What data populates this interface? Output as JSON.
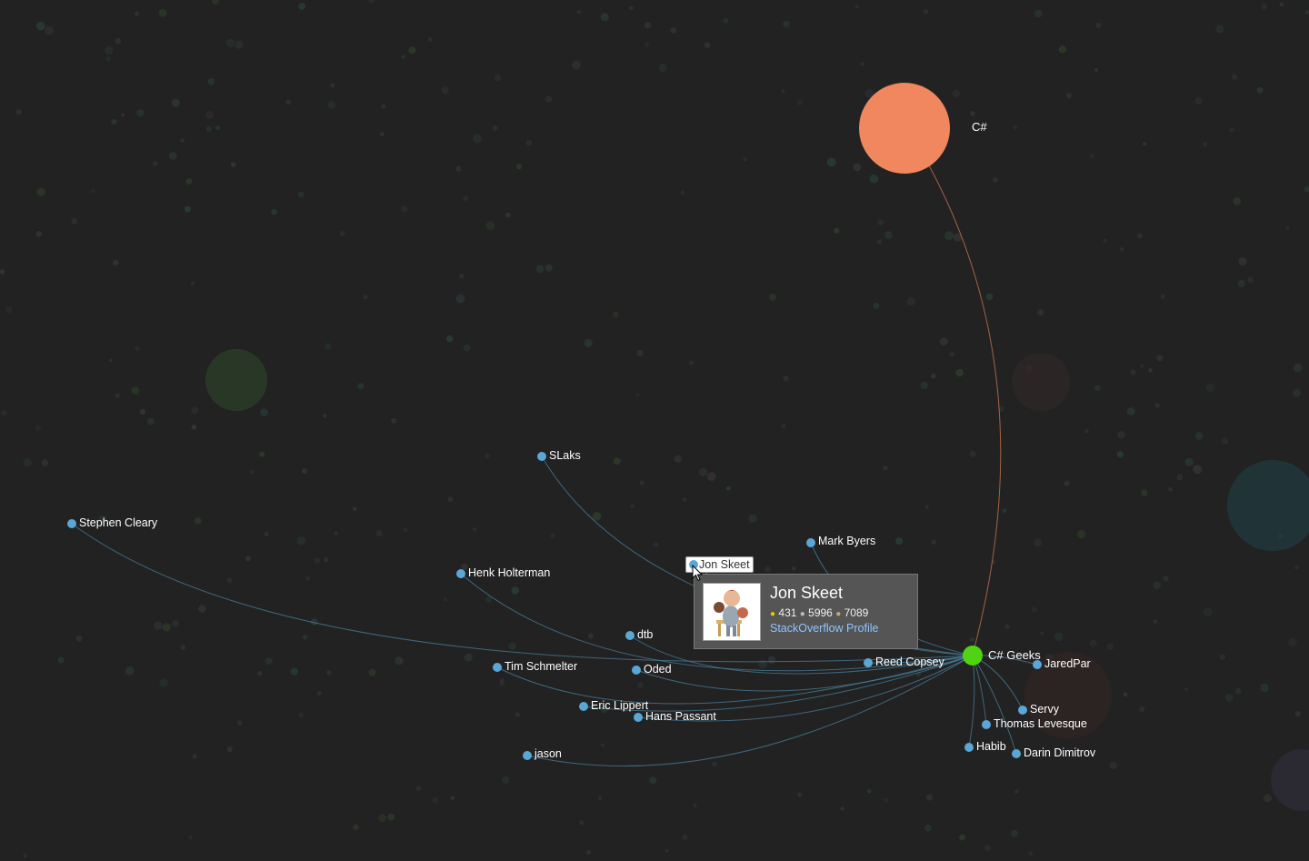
{
  "hubs": [
    {
      "id": "csharp",
      "label": "C#",
      "color": "#f0875e"
    },
    {
      "id": "csharp-geeks",
      "label": "C# Geeks",
      "color": "#4fd312"
    }
  ],
  "users": [
    {
      "label": "SLaks"
    },
    {
      "label": "Stephen Cleary"
    },
    {
      "label": "Mark Byers"
    },
    {
      "label": "Jon Skeet"
    },
    {
      "label": "Henk Holterman"
    },
    {
      "label": "dtb"
    },
    {
      "label": "Tim Schmelter"
    },
    {
      "label": "Oded"
    },
    {
      "label": "Reed Copsey"
    },
    {
      "label": "JaredPar"
    },
    {
      "label": "Eric Lippert"
    },
    {
      "label": "Hans Passant"
    },
    {
      "label": "Servy"
    },
    {
      "label": "Thomas Levesque"
    },
    {
      "label": "jason"
    },
    {
      "label": "Habib"
    },
    {
      "label": "Darin Dimitrov"
    }
  ],
  "hover_label": "Jon Skeet",
  "tooltip": {
    "name": "Jon Skeet",
    "gold": "431",
    "silver": "5996",
    "bronze": "7089",
    "link": "StackOverflow Profile"
  },
  "colors": {
    "background": "#222222",
    "user_node": "#5aa6d6",
    "gold": "#f5c400",
    "silver": "#bbbbbb",
    "bronze": "#d1a27a",
    "link": "#8fc4ff"
  }
}
